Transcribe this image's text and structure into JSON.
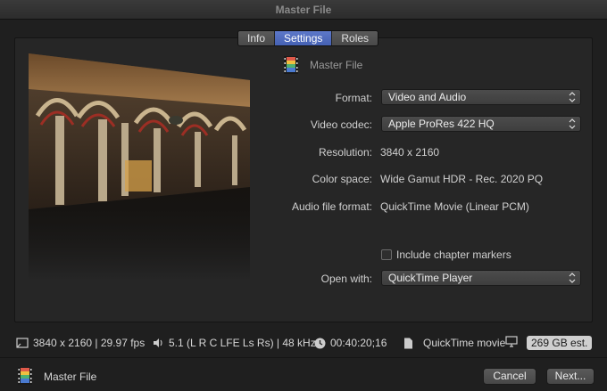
{
  "window": {
    "title": "Master File"
  },
  "tabs": [
    {
      "label": "Info",
      "active": false
    },
    {
      "label": "Settings",
      "active": true
    },
    {
      "label": "Roles",
      "active": false
    }
  ],
  "file": {
    "name": "Master File",
    "icon": "film-icon"
  },
  "settings": {
    "format": {
      "label": "Format:",
      "value": "Video and Audio"
    },
    "video_codec": {
      "label": "Video codec:",
      "value": "Apple ProRes 422 HQ"
    },
    "resolution": {
      "label": "Resolution:",
      "value": "3840 x 2160"
    },
    "color_space": {
      "label": "Color space:",
      "value": "Wide Gamut HDR - Rec. 2020 PQ"
    },
    "audio_file_format": {
      "label": "Audio file format:",
      "value": "QuickTime Movie (Linear PCM)"
    },
    "chapter_markers": {
      "label": "Include chapter markers",
      "checked": false
    },
    "open_with": {
      "label": "Open with:",
      "value": "QuickTime Player"
    }
  },
  "status_bar": {
    "video": "3840 x 2160 | 29.97 fps",
    "audio": "5.1 (L R C LFE Ls Rs) | 48 kHz",
    "duration": "00:40:20;16",
    "container": "QuickTime movie",
    "size_estimate": "269 GB est."
  },
  "footer": {
    "title": "Master File",
    "cancel_label": "Cancel",
    "next_label": "Next..."
  },
  "colors": {
    "accent": "#4f6cc0",
    "background": "#1f1f1f",
    "panel": "#262626"
  }
}
